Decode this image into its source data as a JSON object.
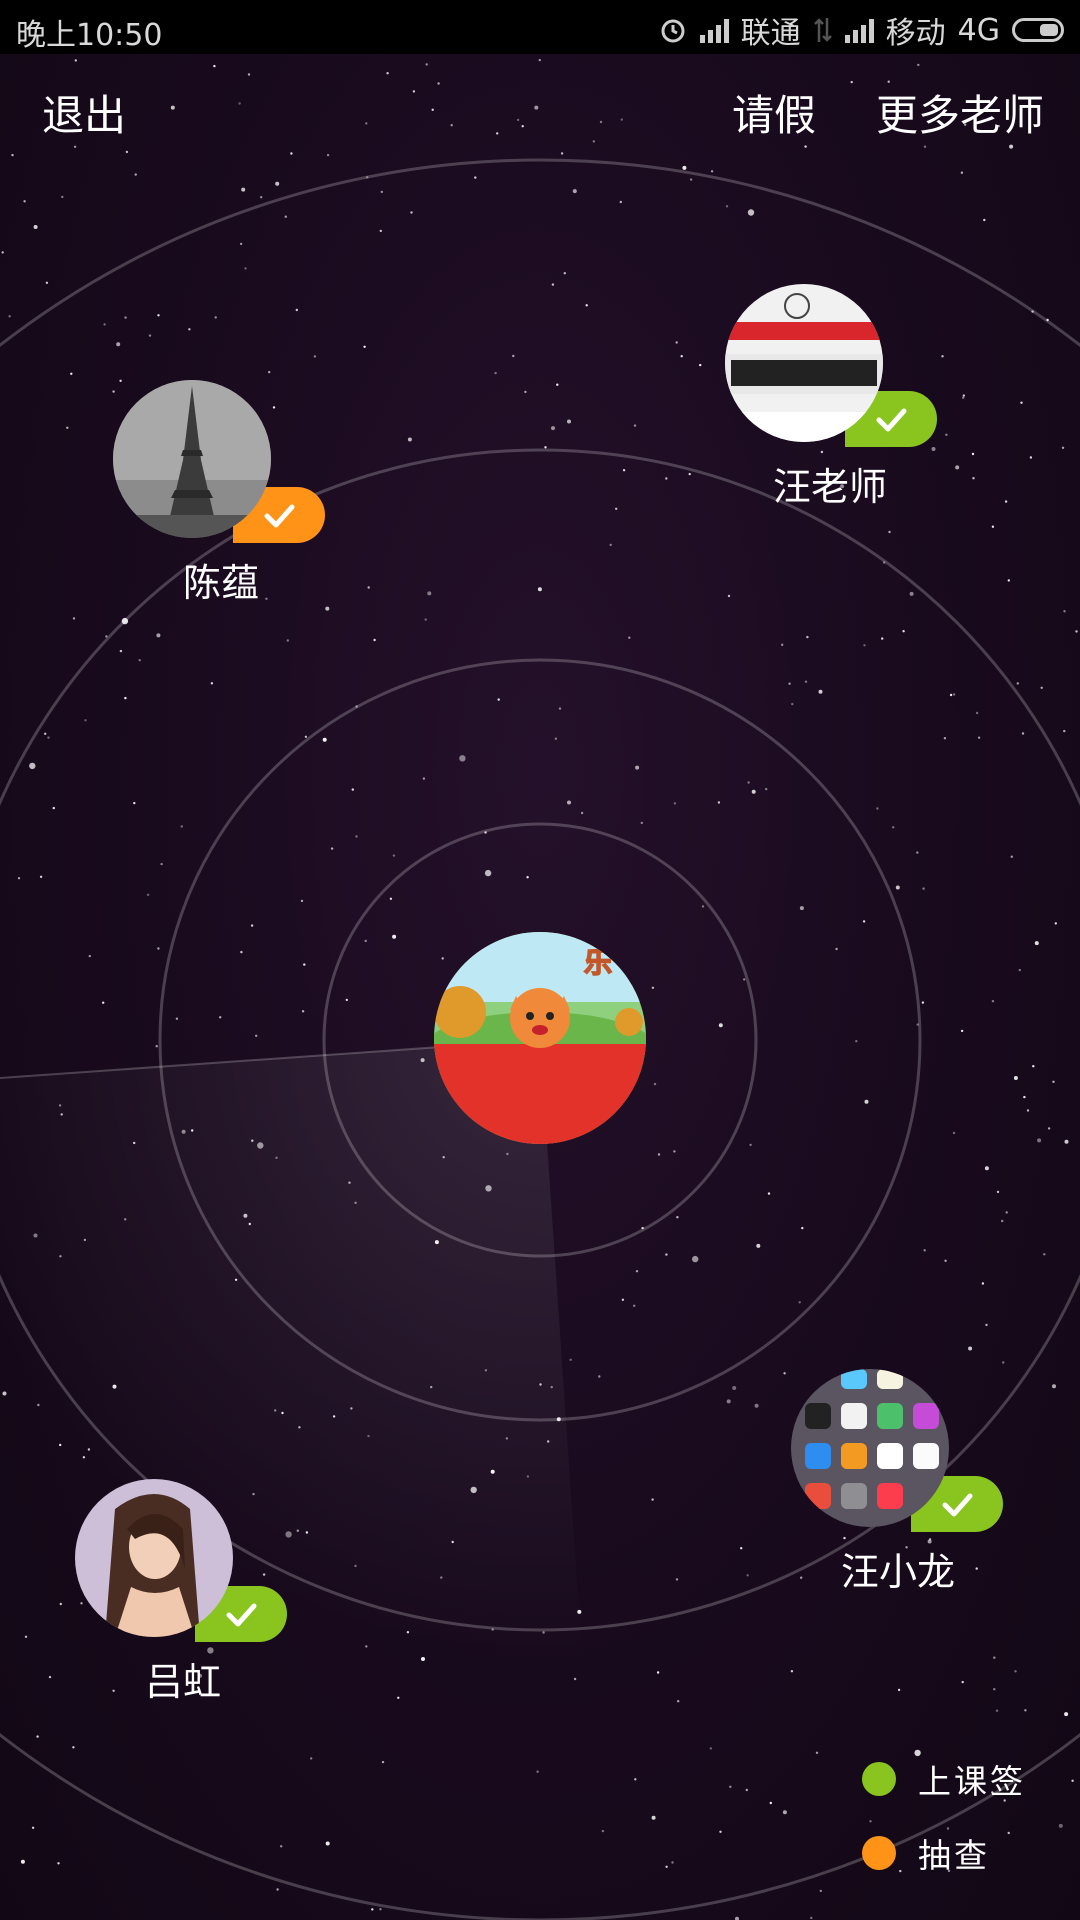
{
  "status_bar": {
    "time": "晚上10:50",
    "carrier1": "联通",
    "carrier2": "移动",
    "network": "4G",
    "icons": [
      "alarm-icon",
      "signal-icon",
      "data-icon",
      "signal-icon",
      "battery-icon"
    ]
  },
  "header": {
    "exit_label": "退出",
    "leave_label": "请假",
    "more_teachers_label": "更多老师"
  },
  "students": [
    {
      "name": "陈蕴",
      "status": "抽查"
    },
    {
      "name": "汪老师",
      "status": "上课签"
    },
    {
      "name": "汪小龙",
      "status": "上课签"
    },
    {
      "name": "吕虹",
      "status": "上课签"
    }
  ],
  "center": {
    "avatar_icon": "cartoon-fox-avatar"
  },
  "legend": {
    "items": [
      {
        "label": "上课签",
        "color": "#8ac41f"
      },
      {
        "label": "抽查",
        "color": "#ff9318"
      }
    ]
  },
  "colors": {
    "checkin": "#8ac41f",
    "spot_check": "#ff9318",
    "background": "#1a0b1f"
  }
}
